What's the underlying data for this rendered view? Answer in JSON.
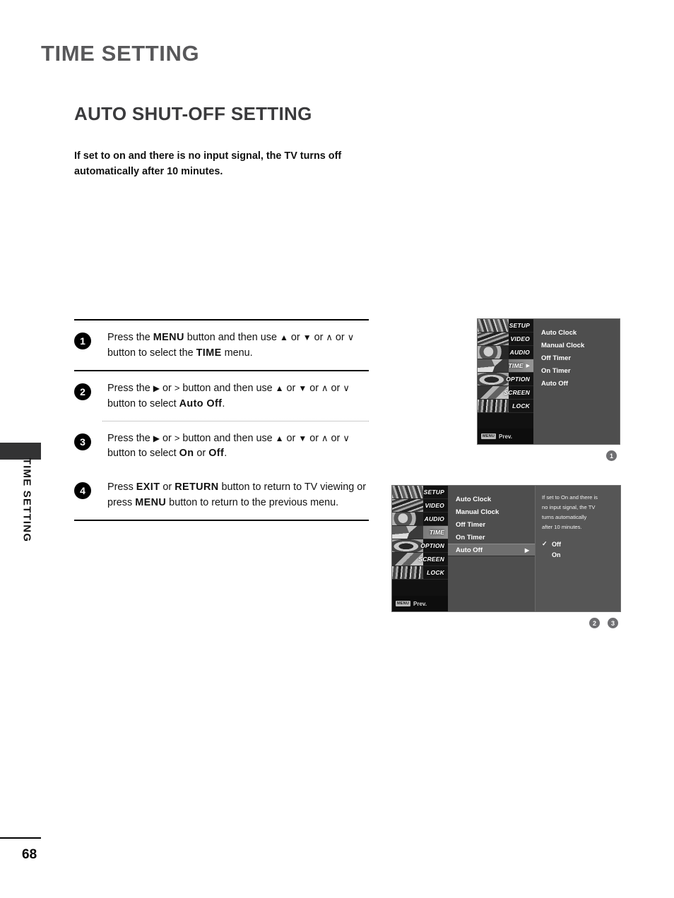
{
  "page": {
    "chapter_title": "TIME SETTING",
    "section_title": "AUTO SHUT-OFF SETTING",
    "intro": "If set to on and there is no input signal, the TV turns off automatically after 10 minutes.",
    "side_tab_label": "TIME SETTING",
    "page_number": "68"
  },
  "steps": [
    {
      "number": "1",
      "parts": [
        {
          "t": "Press the ",
          "b": false
        },
        {
          "t": "MENU",
          "b": true
        },
        {
          "t": " button and then use ",
          "b": false
        },
        {
          "t": "▲",
          "b": false,
          "glyph": true
        },
        {
          "t": " or ",
          "b": false
        },
        {
          "t": "▼",
          "b": false,
          "glyph": true
        },
        {
          "t": "  or  ",
          "b": false
        },
        {
          "t": "∧",
          "b": false,
          "thin": true
        },
        {
          "t": " or ",
          "b": false
        },
        {
          "t": "∨",
          "b": false,
          "thin": true
        },
        {
          "t": "  button to select the ",
          "b": false
        },
        {
          "t": "TIME",
          "b": true
        },
        {
          "t": " menu.",
          "b": false
        }
      ]
    },
    {
      "number": "2",
      "parts": [
        {
          "t": "Press the ",
          "b": false
        },
        {
          "t": "▶",
          "b": false,
          "glyph": true
        },
        {
          "t": "  or  ",
          "b": false
        },
        {
          "t": ">",
          "b": false,
          "thin": true
        },
        {
          "t": "  button and then use ",
          "b": false
        },
        {
          "t": "▲",
          "b": false,
          "glyph": true
        },
        {
          "t": " or ",
          "b": false
        },
        {
          "t": "▼",
          "b": false,
          "glyph": true
        },
        {
          "t": "  or  ",
          "b": false
        },
        {
          "t": "∧",
          "b": false,
          "thin": true
        },
        {
          "t": " or ",
          "b": false
        },
        {
          "t": "∨",
          "b": false,
          "thin": true
        },
        {
          "t": "  button to select ",
          "b": false
        },
        {
          "t": "Auto Off",
          "b": true
        },
        {
          "t": ".",
          "b": false
        }
      ]
    },
    {
      "number": "3",
      "parts": [
        {
          "t": "Press the ",
          "b": false
        },
        {
          "t": "▶",
          "b": false,
          "glyph": true
        },
        {
          "t": "  or  ",
          "b": false
        },
        {
          "t": ">",
          "b": false,
          "thin": true
        },
        {
          "t": "  button and then use ",
          "b": false
        },
        {
          "t": "▲",
          "b": false,
          "glyph": true
        },
        {
          "t": " or ",
          "b": false
        },
        {
          "t": "▼",
          "b": false,
          "glyph": true
        },
        {
          "t": "  or  ",
          "b": false
        },
        {
          "t": "∧",
          "b": false,
          "thin": true
        },
        {
          "t": " or ",
          "b": false
        },
        {
          "t": "∨",
          "b": false,
          "thin": true
        },
        {
          "t": "  button to select ",
          "b": false
        },
        {
          "t": "On",
          "b": true
        },
        {
          "t": " or ",
          "b": false
        },
        {
          "t": "Off",
          "b": true
        },
        {
          "t": ".",
          "b": false
        }
      ]
    },
    {
      "number": "4",
      "parts": [
        {
          "t": "Press ",
          "b": false
        },
        {
          "t": "EXIT",
          "b": true
        },
        {
          "t": " or ",
          "b": false
        },
        {
          "t": "RETURN",
          "b": true
        },
        {
          "t": " button to return to TV viewing or press ",
          "b": false
        },
        {
          "t": "MENU",
          "b": true
        },
        {
          "t": " button to return to the previous menu.",
          "b": false
        }
      ]
    }
  ],
  "osd": {
    "sidebar_items": [
      {
        "label": "SETUP",
        "active": false
      },
      {
        "label": "VIDEO",
        "active": false
      },
      {
        "label": "AUDIO",
        "active": false
      },
      {
        "label": "TIME",
        "active": true
      },
      {
        "label": "OPTION",
        "active": false
      },
      {
        "label": "SCREEN",
        "active": false
      },
      {
        "label": "LOCK",
        "active": false
      }
    ],
    "menu_key_label": "MENU",
    "prev_label": "Prev.",
    "time_menu_items": [
      "Auto Clock",
      "Manual Clock",
      "Off Timer",
      "On Timer",
      "Auto Off"
    ],
    "selected_item": "Auto Off",
    "row_arrow": "▶",
    "detail_lines": [
      "If set to On and there is",
      "no input signal, the TV",
      "turns automatically",
      "after 10 minutes."
    ],
    "options": [
      {
        "label": "Off",
        "checked": true,
        "check": "✓"
      },
      {
        "label": "On",
        "checked": false,
        "check": ""
      }
    ]
  },
  "figure_markers": {
    "top": [
      "1"
    ],
    "bottom": [
      "2",
      "3"
    ]
  },
  "colors": {
    "chapter_title": "#58585a",
    "section_title": "#3a3a3c",
    "osd_panel": "#4e4e4e",
    "osd_detail": "#565656",
    "osd_selected_row": "#6f6f6f",
    "marker": "#6f6f72",
    "side_tab": "#333334"
  }
}
